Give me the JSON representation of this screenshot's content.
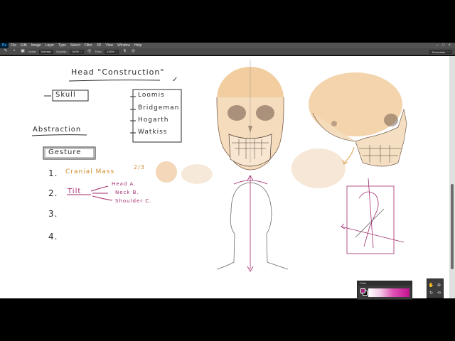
{
  "app": {
    "logo": "Ps",
    "menu": [
      "File",
      "Edit",
      "Image",
      "Layer",
      "Type",
      "Select",
      "Filter",
      "3D",
      "View",
      "Window",
      "Help"
    ],
    "window_controls": [
      "–",
      "□",
      "×"
    ]
  },
  "options_bar": {
    "mode_label": "Mode:",
    "mode_value": "Normal",
    "opacity_label": "Opacity:",
    "opacity_value": "100%",
    "flow_label": "Flow:",
    "flow_value": "100%",
    "workspace": "Essentials"
  },
  "canvas": {
    "title": "Head \"Construction\"",
    "check": "✓",
    "skull_box": "Skull",
    "artists": [
      "Loomis",
      "Bridgeman",
      "Hogarth",
      "Watkiss"
    ],
    "abstraction": "Abstraction",
    "gesture": "Gesture",
    "list_numbers": [
      "1.",
      "2.",
      "3.",
      "4."
    ],
    "item1": "Cranial Mass",
    "item1_fraction": "2/3",
    "item2": "Tilt",
    "tilt_subitems": [
      "Head A.",
      "Neck B.",
      "Shoulder C."
    ]
  },
  "panels": {
    "color_title": "Color",
    "tool_icons": [
      "hand-icon",
      "zoom-icon",
      "rotate-icon",
      "reset-icon"
    ]
  },
  "colors": {
    "ink": "#2a2a2a",
    "orange": "#d28a2e",
    "magenta": "#a32b6e",
    "skull_fill": "#f2cfa3"
  }
}
